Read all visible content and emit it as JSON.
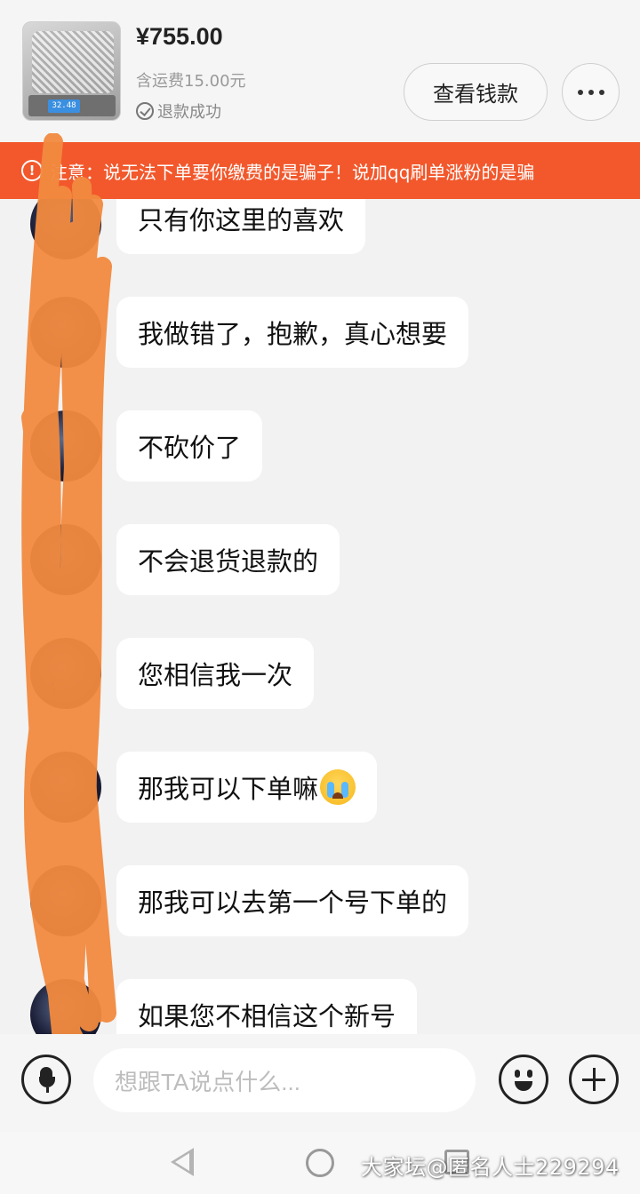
{
  "product": {
    "price": "¥755.00",
    "shipping": "含运费15.00元",
    "status": "退款成功",
    "scale_reading": "32.48"
  },
  "header": {
    "refund_button": "查看钱款"
  },
  "warning": {
    "text": "注意：说无法下单要你缴费的是骗子！说加qq刷单涨粉的是骗"
  },
  "messages": [
    {
      "text": "只有你这里的喜欢"
    },
    {
      "text": "我做错了，抱歉，真心想要"
    },
    {
      "text": "不砍价了"
    },
    {
      "text": "不会退货退款的"
    },
    {
      "text": "您相信我一次"
    },
    {
      "text": "那我可以下单嘛"
    },
    {
      "text": "那我可以去第一个号下单的"
    },
    {
      "text": "如果您不相信这个新号"
    }
  ],
  "input": {
    "placeholder": "想跟TA说点什么..."
  },
  "watermark": "大家坛@匿名人士229294",
  "colors": {
    "warning_bg": "#f2582c",
    "scribble": "#f28a3f",
    "bubble_bg": "#ffffff",
    "page_bg": "#f2f2f2"
  },
  "icons": {
    "status": "check-circle-icon",
    "more": "more-dots-icon",
    "warning": "exclamation-circle-icon",
    "voice": "microphone-icon",
    "emoji": "smile-icon",
    "add": "plus-icon",
    "crying_emoji": "loudly-crying-face-icon"
  }
}
